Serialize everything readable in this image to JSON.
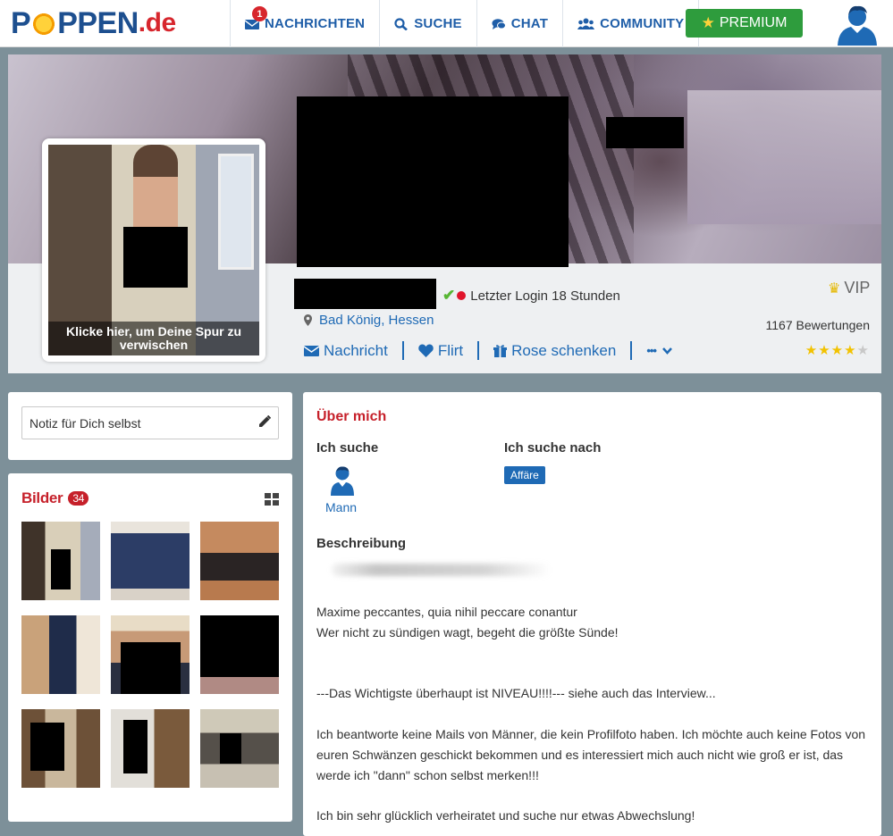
{
  "header": {
    "logo_main": "P",
    "logo_rest": "PPEN",
    "logo_tld": ".de",
    "nav": [
      {
        "label": "NACHRICHTEN",
        "icon": "envelope-icon",
        "badge": "1"
      },
      {
        "label": "SUCHE",
        "icon": "search-icon"
      },
      {
        "label": "CHAT",
        "icon": "chat-icon"
      },
      {
        "label": "COMMUNITY",
        "icon": "community-icon"
      }
    ],
    "premium_label": "PREMIUM",
    "avatar_icon": "user-avatar-icon"
  },
  "profile": {
    "photo_cta": "Klicke hier, um Deine Spur zu verwischen",
    "last_login": "Letzter Login 18 Stunden",
    "location": "Bad König, Hessen",
    "actions": {
      "message": "Nachricht",
      "flirt": "Flirt",
      "rose": "Rose schenken",
      "more": "•••"
    },
    "vip_label": "VIP",
    "ratings_count": "1167 Bewertungen",
    "rating_stars": 4,
    "rating_max": 5
  },
  "sidebar": {
    "note_placeholder": "Notiz für Dich selbst",
    "pictures_title": "Bilder",
    "pictures_count": "34"
  },
  "about": {
    "title": "Über mich",
    "seeking_label": "Ich suche",
    "seeking_value": "Mann",
    "seeking_for_label": "Ich suche nach",
    "seeking_for_tag": "Affäre",
    "description_label": "Beschreibung",
    "description_lines": [
      "Maxime peccantes, quia nihil peccare conantur",
      "Wer nicht zu sündigen wagt, begeht die größte Sünde!",
      "---Das Wichtigste überhaupt ist NIVEAU!!!!--- siehe auch das Interview...",
      "Ich beantworte keine Mails von Männer, die kein Profilfoto haben. Ich möchte auch keine Fotos von euren Schwänzen geschickt bekommen und es interessiert mich auch nicht wie groß er ist, das werde ich \"dann\" schon selbst merken!!!",
      "Ich bin sehr glücklich verheiratet und suche nur etwas Abwechslung!"
    ]
  },
  "colors": {
    "brand_blue": "#1f5ea8",
    "brand_red": "#c6202a",
    "premium_green": "#2e9c3d"
  }
}
